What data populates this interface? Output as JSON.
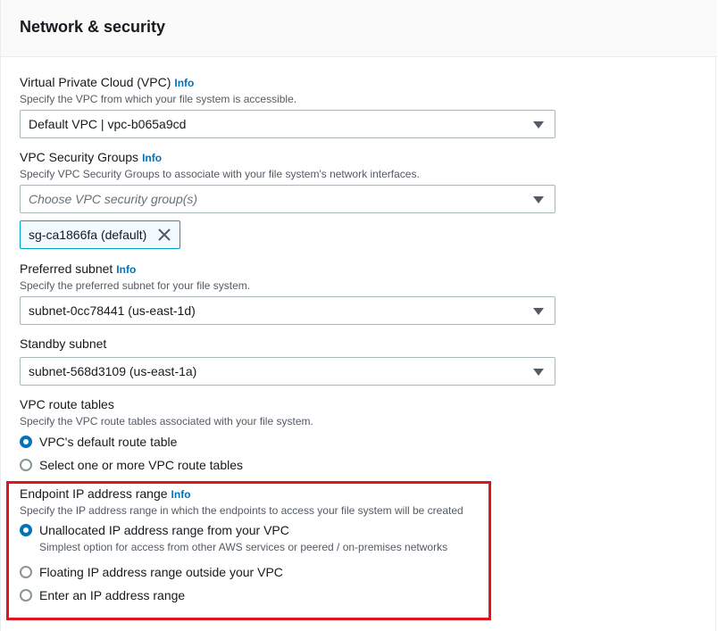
{
  "panel": {
    "title": "Network & security"
  },
  "info_label": "Info",
  "vpc": {
    "label": "Virtual Private Cloud (VPC)",
    "description": "Specify the VPC from which your file system is accessible.",
    "value": "Default VPC | vpc-b065a9cd"
  },
  "security_groups": {
    "label": "VPC Security Groups",
    "description": "Specify VPC Security Groups to associate with your file system's network interfaces.",
    "placeholder": "Choose VPC security group(s)",
    "tokens": [
      "sg-ca1866fa (default)"
    ]
  },
  "preferred_subnet": {
    "label": "Preferred subnet",
    "description": "Specify the preferred subnet for your file system.",
    "value": "subnet-0cc78441 (us-east-1d)"
  },
  "standby_subnet": {
    "label": "Standby subnet",
    "value": "subnet-568d3109 (us-east-1a)"
  },
  "route_tables": {
    "label": "VPC route tables",
    "description": "Specify the VPC route tables associated with your file system.",
    "options": [
      {
        "label": "VPC's default route table",
        "checked": true
      },
      {
        "label": "Select one or more VPC route tables",
        "checked": false
      }
    ]
  },
  "endpoint_ip": {
    "label": "Endpoint IP address range",
    "description": "Specify the IP address range in which the endpoints to access your file system will be created",
    "options": [
      {
        "label": "Unallocated IP address range from your VPC",
        "description": "Simplest option for access from other AWS services or peered / on-premises networks",
        "checked": true
      },
      {
        "label": "Floating IP address range outside your VPC",
        "checked": false
      },
      {
        "label": "Enter an IP address range",
        "checked": false
      }
    ]
  },
  "colors": {
    "accent": "#0073bb",
    "highlight": "#e0161e",
    "token_border": "#00a1c9"
  }
}
